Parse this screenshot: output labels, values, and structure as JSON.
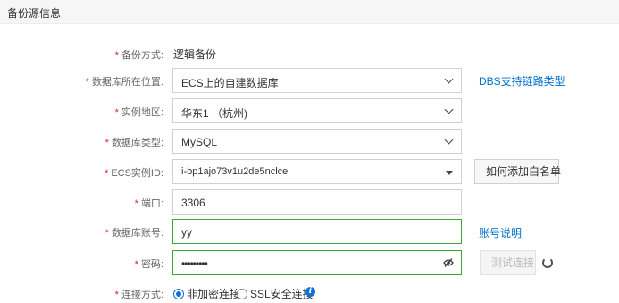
{
  "section": {
    "title": "备份源信息"
  },
  "backup_method": {
    "label": "备份方式:",
    "value": "逻辑备份"
  },
  "db_location": {
    "label": "数据库所在位置:",
    "value": "ECS上的自建数据库",
    "link": "DBS支持链路类型"
  },
  "region": {
    "label": "实例地区:",
    "value": "华东1 （杭州)"
  },
  "db_type": {
    "label": "数据库类型:",
    "value": "MySQL"
  },
  "ecs_instance": {
    "label": "ECS实例ID:",
    "value": "i-bp1ajo73v1u2de5nclce",
    "button": "如何添加白名单"
  },
  "port": {
    "label": "端口:",
    "value": "3306"
  },
  "account": {
    "label": "数据库账号:",
    "value": "yy",
    "link": "账号说明"
  },
  "password": {
    "label": "密码:",
    "value": "•••••••••",
    "button": "测试连接"
  },
  "connection": {
    "label": "连接方式:",
    "options": [
      {
        "label": "非加密连接",
        "checked": true
      },
      {
        "label": "SSL安全连接",
        "checked": false
      }
    ],
    "info_icon": "i"
  },
  "required_mark": "*"
}
